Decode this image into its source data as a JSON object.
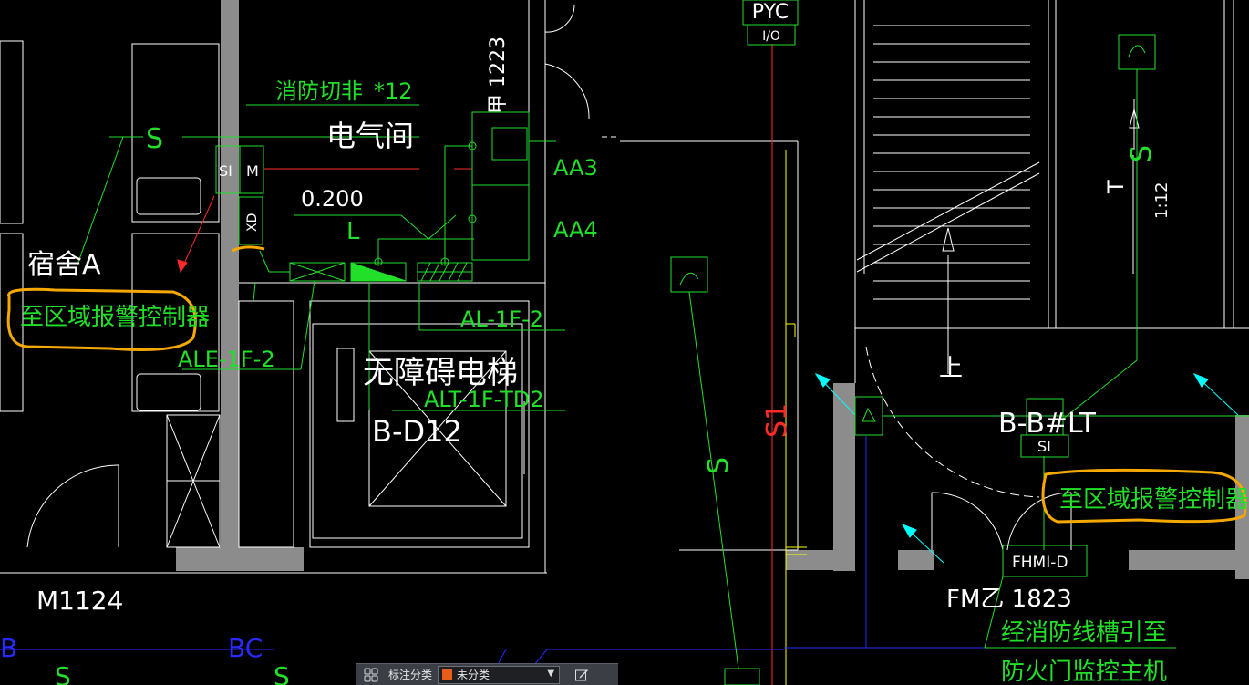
{
  "drawing": {
    "labels": {
      "pyc": "PYC",
      "io": "I/O",
      "door_1223": "甲 1223",
      "fire_cutoff": "消防切非",
      "count12": "*12",
      "elec_room": "电气间",
      "si": "SI",
      "m": "M",
      "xd": "XD",
      "elev_0200": "0.200",
      "aa3": "AA3",
      "aa4": "AA4",
      "dorm_a": "宿舍A",
      "to_alarm_left": "至区域报警控制器",
      "ale": "ALE-1F-2",
      "al": "AL-1F-2",
      "barrier_free_lift": "无障碍电梯",
      "alt": "ALT-1F-TD2",
      "b_d12": "B-D12",
      "s1": "S1",
      "ratio": "1:12",
      "up_t": "上",
      "up_bottom": "上",
      "b_b_lt": "B-B#LT",
      "si_right": "SI",
      "to_alarm_right": "至区域报警控制器",
      "fhmi": "FHMI-D",
      "fm_door": "FM乙 1823",
      "route1": "经消防线槽引至",
      "route2": "防火门监控主机",
      "m1124": "M1124",
      "b_left": "B",
      "bc": "BC"
    }
  },
  "toolbar": {
    "grid_icon": "grid-icon",
    "category_label": "标注分类",
    "category_value": "未分类",
    "category_color": "#e85d1a",
    "edit_icon": "edit-icon"
  },
  "colors": {
    "background": "#000000",
    "green": "#22e02a",
    "wall": "#8c8c8c",
    "white": "#ffffff",
    "red": "#ff2a2a",
    "yellow": "#ffff00",
    "blue": "#2a2aff",
    "cyan": "#00ffff",
    "highlight": "#f5a800"
  }
}
